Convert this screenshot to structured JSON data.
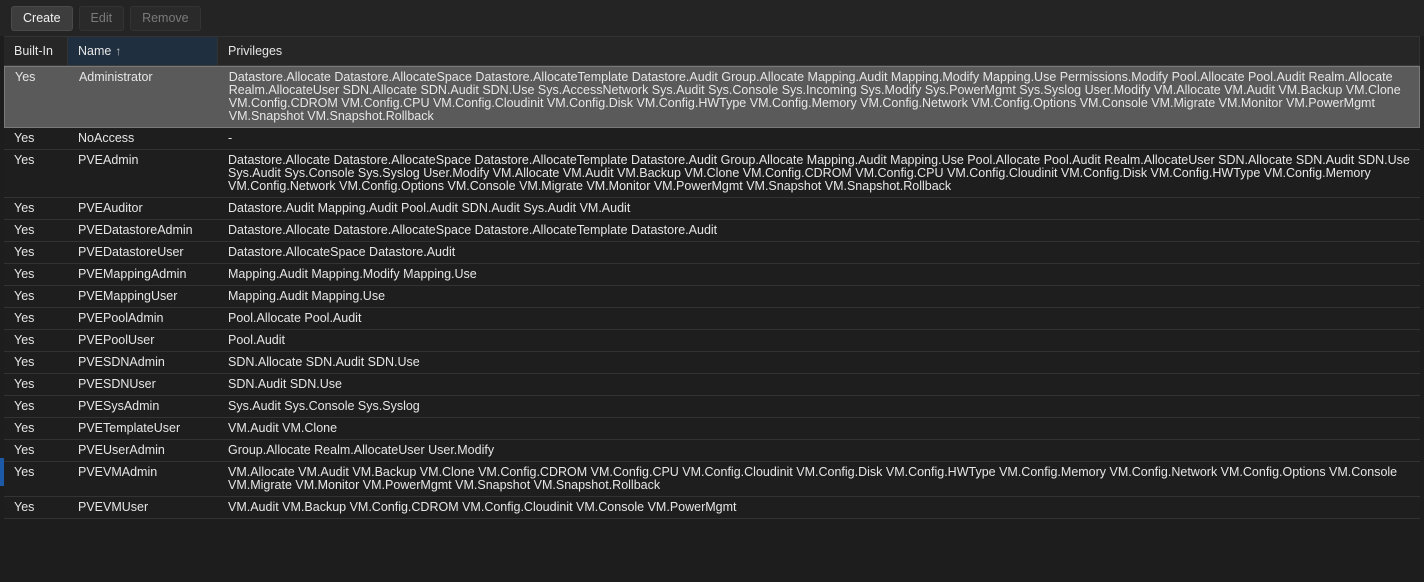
{
  "toolbar": {
    "create_label": "Create",
    "edit_label": "Edit",
    "remove_label": "Remove"
  },
  "columns": {
    "builtin": "Built-In",
    "name": "Name",
    "name_sort_icon": "sort-ascending-arrow",
    "privileges": "Privileges"
  },
  "rows": [
    {
      "builtin": "Yes",
      "name": "Administrator",
      "privileges": "Datastore.Allocate Datastore.AllocateSpace Datastore.AllocateTemplate Datastore.Audit Group.Allocate Mapping.Audit Mapping.Modify Mapping.Use Permissions.Modify Pool.Allocate Pool.Audit Realm.Allocate Realm.AllocateUser SDN.Allocate SDN.Audit SDN.Use Sys.AccessNetwork Sys.Audit Sys.Console Sys.Incoming Sys.Modify Sys.PowerMgmt Sys.Syslog User.Modify VM.Allocate VM.Audit VM.Backup VM.Clone VM.Config.CDROM VM.Config.CPU VM.Config.Cloudinit VM.Config.Disk VM.Config.HWType VM.Config.Memory VM.Config.Network VM.Config.Options VM.Console VM.Migrate VM.Monitor VM.PowerMgmt VM.Snapshot VM.Snapshot.Rollback",
      "selected": true
    },
    {
      "builtin": "Yes",
      "name": "NoAccess",
      "privileges": "-"
    },
    {
      "builtin": "Yes",
      "name": "PVEAdmin",
      "privileges": "Datastore.Allocate Datastore.AllocateSpace Datastore.AllocateTemplate Datastore.Audit Group.Allocate Mapping.Audit Mapping.Use Pool.Allocate Pool.Audit Realm.AllocateUser SDN.Allocate SDN.Audit SDN.Use Sys.Audit Sys.Console Sys.Syslog User.Modify VM.Allocate VM.Audit VM.Backup VM.Clone VM.Config.CDROM VM.Config.CPU VM.Config.Cloudinit VM.Config.Disk VM.Config.HWType VM.Config.Memory VM.Config.Network VM.Config.Options VM.Console VM.Migrate VM.Monitor VM.PowerMgmt VM.Snapshot VM.Snapshot.Rollback"
    },
    {
      "builtin": "Yes",
      "name": "PVEAuditor",
      "privileges": "Datastore.Audit Mapping.Audit Pool.Audit SDN.Audit Sys.Audit VM.Audit"
    },
    {
      "builtin": "Yes",
      "name": "PVEDatastoreAdmin",
      "privileges": "Datastore.Allocate Datastore.AllocateSpace Datastore.AllocateTemplate Datastore.Audit"
    },
    {
      "builtin": "Yes",
      "name": "PVEDatastoreUser",
      "privileges": "Datastore.AllocateSpace Datastore.Audit"
    },
    {
      "builtin": "Yes",
      "name": "PVEMappingAdmin",
      "privileges": "Mapping.Audit Mapping.Modify Mapping.Use"
    },
    {
      "builtin": "Yes",
      "name": "PVEMappingUser",
      "privileges": "Mapping.Audit Mapping.Use"
    },
    {
      "builtin": "Yes",
      "name": "PVEPoolAdmin",
      "privileges": "Pool.Allocate Pool.Audit"
    },
    {
      "builtin": "Yes",
      "name": "PVEPoolUser",
      "privileges": "Pool.Audit"
    },
    {
      "builtin": "Yes",
      "name": "PVESDNAdmin",
      "privileges": "SDN.Allocate SDN.Audit SDN.Use"
    },
    {
      "builtin": "Yes",
      "name": "PVESDNUser",
      "privileges": "SDN.Audit SDN.Use"
    },
    {
      "builtin": "Yes",
      "name": "PVESysAdmin",
      "privileges": "Sys.Audit Sys.Console Sys.Syslog"
    },
    {
      "builtin": "Yes",
      "name": "PVETemplateUser",
      "privileges": "VM.Audit VM.Clone"
    },
    {
      "builtin": "Yes",
      "name": "PVEUserAdmin",
      "privileges": "Group.Allocate Realm.AllocateUser User.Modify"
    },
    {
      "builtin": "Yes",
      "name": "PVEVMAdmin",
      "privileges": "VM.Allocate VM.Audit VM.Backup VM.Clone VM.Config.CDROM VM.Config.CPU VM.Config.Cloudinit VM.Config.Disk VM.Config.HWType VM.Config.Memory VM.Config.Network VM.Config.Options VM.Console VM.Migrate VM.Monitor VM.PowerMgmt VM.Snapshot VM.Snapshot.Rollback"
    },
    {
      "builtin": "Yes",
      "name": "PVEVMUser",
      "privileges": "VM.Audit VM.Backup VM.Config.CDROM VM.Config.Cloudinit VM.Console VM.PowerMgmt"
    }
  ]
}
